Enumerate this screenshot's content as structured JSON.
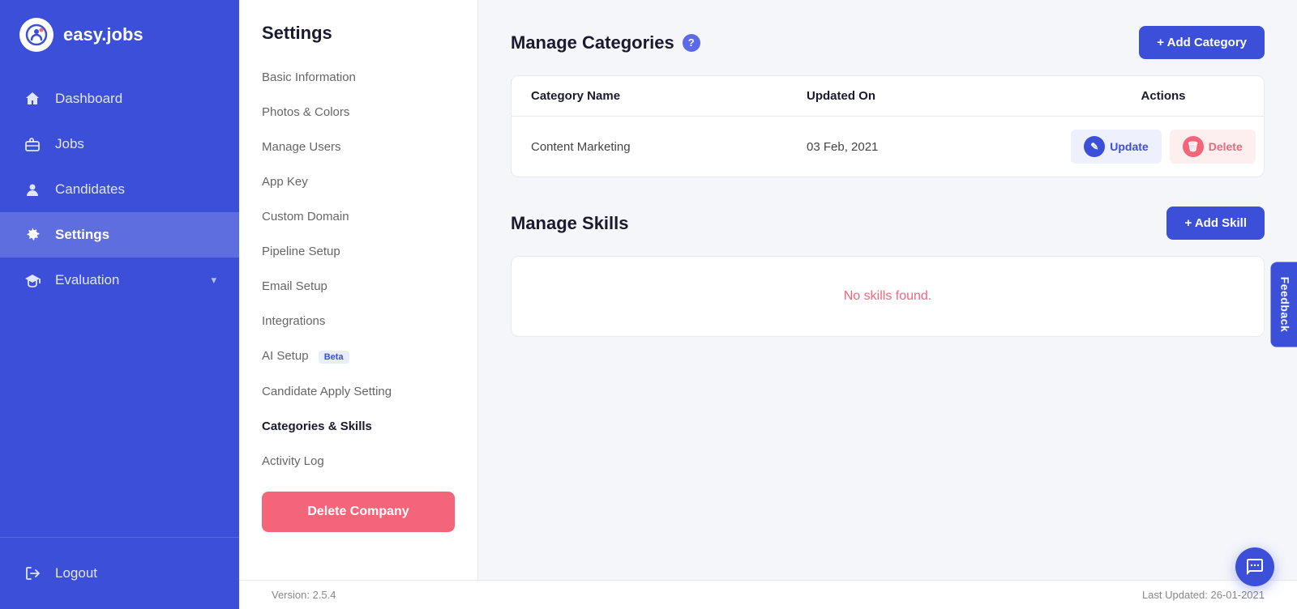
{
  "sidebar": {
    "logo_text": "easy.jobs",
    "nav_items": [
      {
        "id": "dashboard",
        "label": "Dashboard",
        "icon": "home"
      },
      {
        "id": "jobs",
        "label": "Jobs",
        "icon": "briefcase"
      },
      {
        "id": "candidates",
        "label": "Candidates",
        "icon": "person"
      },
      {
        "id": "settings",
        "label": "Settings",
        "icon": "gear",
        "active": true
      },
      {
        "id": "evaluation",
        "label": "Evaluation",
        "icon": "graduation",
        "has_chevron": true
      }
    ],
    "logout_label": "Logout"
  },
  "settings_menu": {
    "title": "Settings",
    "items": [
      {
        "id": "basic-information",
        "label": "Basic Information",
        "active": false
      },
      {
        "id": "photos-colors",
        "label": "Photos & Colors",
        "active": false
      },
      {
        "id": "manage-users",
        "label": "Manage Users",
        "active": false
      },
      {
        "id": "app-key",
        "label": "App Key",
        "active": false
      },
      {
        "id": "custom-domain",
        "label": "Custom Domain",
        "active": false
      },
      {
        "id": "pipeline-setup",
        "label": "Pipeline Setup",
        "active": false
      },
      {
        "id": "email-setup",
        "label": "Email Setup",
        "active": false
      },
      {
        "id": "integrations",
        "label": "Integrations",
        "active": false
      },
      {
        "id": "ai-setup",
        "label": "AI Setup",
        "badge": "Beta",
        "active": false
      },
      {
        "id": "candidate-apply-setting",
        "label": "Candidate Apply Setting",
        "active": false
      },
      {
        "id": "categories-skills",
        "label": "Categories & Skills",
        "active": true
      },
      {
        "id": "activity-log",
        "label": "Activity Log",
        "active": false
      }
    ],
    "delete_company_label": "Delete Company"
  },
  "categories": {
    "section_title": "Manage Categories",
    "add_button_label": "+ Add Category",
    "table": {
      "columns": [
        "Category Name",
        "Updated On",
        "Actions"
      ],
      "rows": [
        {
          "category_name": "Content Marketing",
          "updated_on": "03 Feb, 2021",
          "update_label": "Update",
          "delete_label": "Delete"
        }
      ]
    }
  },
  "skills": {
    "section_title": "Manage Skills",
    "add_button_label": "+ Add Skill",
    "no_data_message": "No skills found."
  },
  "footer": {
    "version": "Version: 2.5.4",
    "last_updated": "Last Updated: 26-01-2021"
  },
  "feedback_label": "Feedback"
}
